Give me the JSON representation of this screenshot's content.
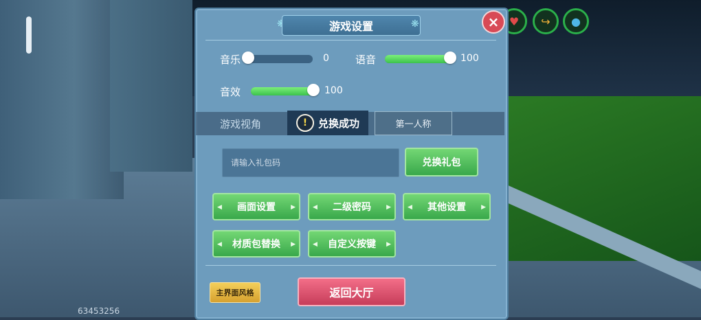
{
  "hud": {
    "player_id": "63453256"
  },
  "settings": {
    "title": "游戏设置",
    "close_icon": "×",
    "music": {
      "label": "音乐",
      "value_text": "0",
      "level": 0
    },
    "voice": {
      "label": "语音",
      "value_text": "100",
      "level": 100
    },
    "sfx": {
      "label": "音效",
      "value_text": "100",
      "level": 100
    },
    "view": {
      "label": "游戏视角",
      "option": "第一人称"
    },
    "toast": {
      "icon": "!",
      "text": "兑换成功"
    },
    "gift": {
      "placeholder": "请输入礼包码",
      "button": "兑换礼包"
    },
    "buttons": [
      "画面设置",
      "二级密码",
      "其他设置",
      "材质包替换",
      "自定义按键"
    ],
    "style_button": "主界面风格",
    "back_button": "返回大厅"
  },
  "colors": {
    "accent_green": "#3cc24c",
    "danger_red": "#d84a56",
    "back_pink": "#c63d5a",
    "gold": "#d6a12f"
  },
  "icons": [
    "heart-icon",
    "share-icon",
    "water-drop-icon",
    "close-icon",
    "warning-icon"
  ]
}
